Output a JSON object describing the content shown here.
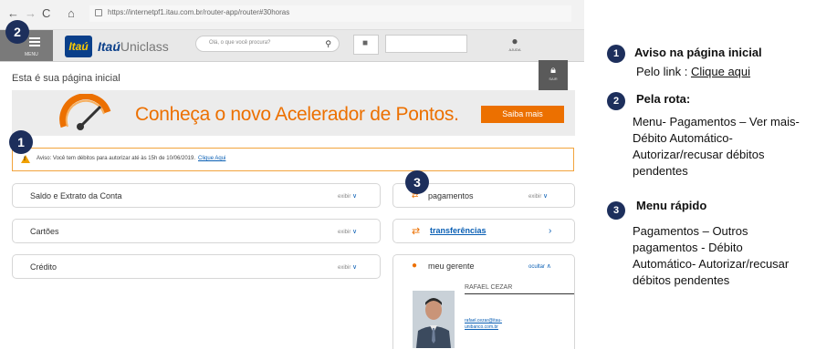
{
  "browser": {
    "nav_back": "←",
    "nav_forward": "→",
    "nav_reload": "C",
    "nav_home": "⌂",
    "url": "https://internetpf1.itau.com.br/router-app/router#30horas"
  },
  "header": {
    "menu_label": "MENU",
    "logo_text": "Itaú",
    "brand_bold": "Itaú",
    "brand_light": "Uniclass",
    "search_placeholder": "Olá, o que você procura?",
    "ajuda_label": "AJUDA",
    "sair_label": "SAIR"
  },
  "page": {
    "title": "Esta é sua página inicial"
  },
  "banner": {
    "text": "Conheça o novo Acelerador de Pontos.",
    "button": "Saiba mais"
  },
  "notice": {
    "text": "Aviso: Você tem débitos para autorizar até às 15h de 10/06/2019.",
    "link": "Clique Aqui"
  },
  "left_cards": [
    {
      "title": "Saldo e Extrato da Conta",
      "action": "exibir"
    },
    {
      "title": "Cartões",
      "action": "exibir"
    },
    {
      "title": "Crédito",
      "action": "exibir"
    }
  ],
  "right_cards": {
    "pagamentos": {
      "title": "pagamentos",
      "action": "exibir"
    },
    "transferencias": {
      "title": "transferências"
    },
    "gerente": {
      "title": "meu gerente",
      "action": "ocultar",
      "name": "RAFAEL CEZAR",
      "email": "rafael.cezar@itau-unibanco.com.br"
    }
  },
  "badges": [
    "2",
    "1",
    "3"
  ],
  "notes": [
    {
      "num": "1",
      "title": "Aviso na página inicial",
      "prefix": "Pelo link : ",
      "link": "Clique aqui"
    },
    {
      "num": "2",
      "title": "Pela rota:",
      "lines": [
        "Menu- Pagamentos – Ver mais-",
        "Débito Automático-",
        "Autorizar/recusar débitos",
        "pendentes"
      ]
    },
    {
      "num": "3",
      "title": "Menu rápido",
      "lines": [
        "Pagamentos – Outros",
        "pagamentos - Débito",
        "Automático- Autorizar/recusar",
        "débitos pendentes"
      ]
    }
  ],
  "colors": {
    "accent_orange": "#ec7000",
    "brand_blue": "#0a3f8a",
    "badge_navy": "#1d2f5c",
    "warning_border": "#f2a33c"
  }
}
